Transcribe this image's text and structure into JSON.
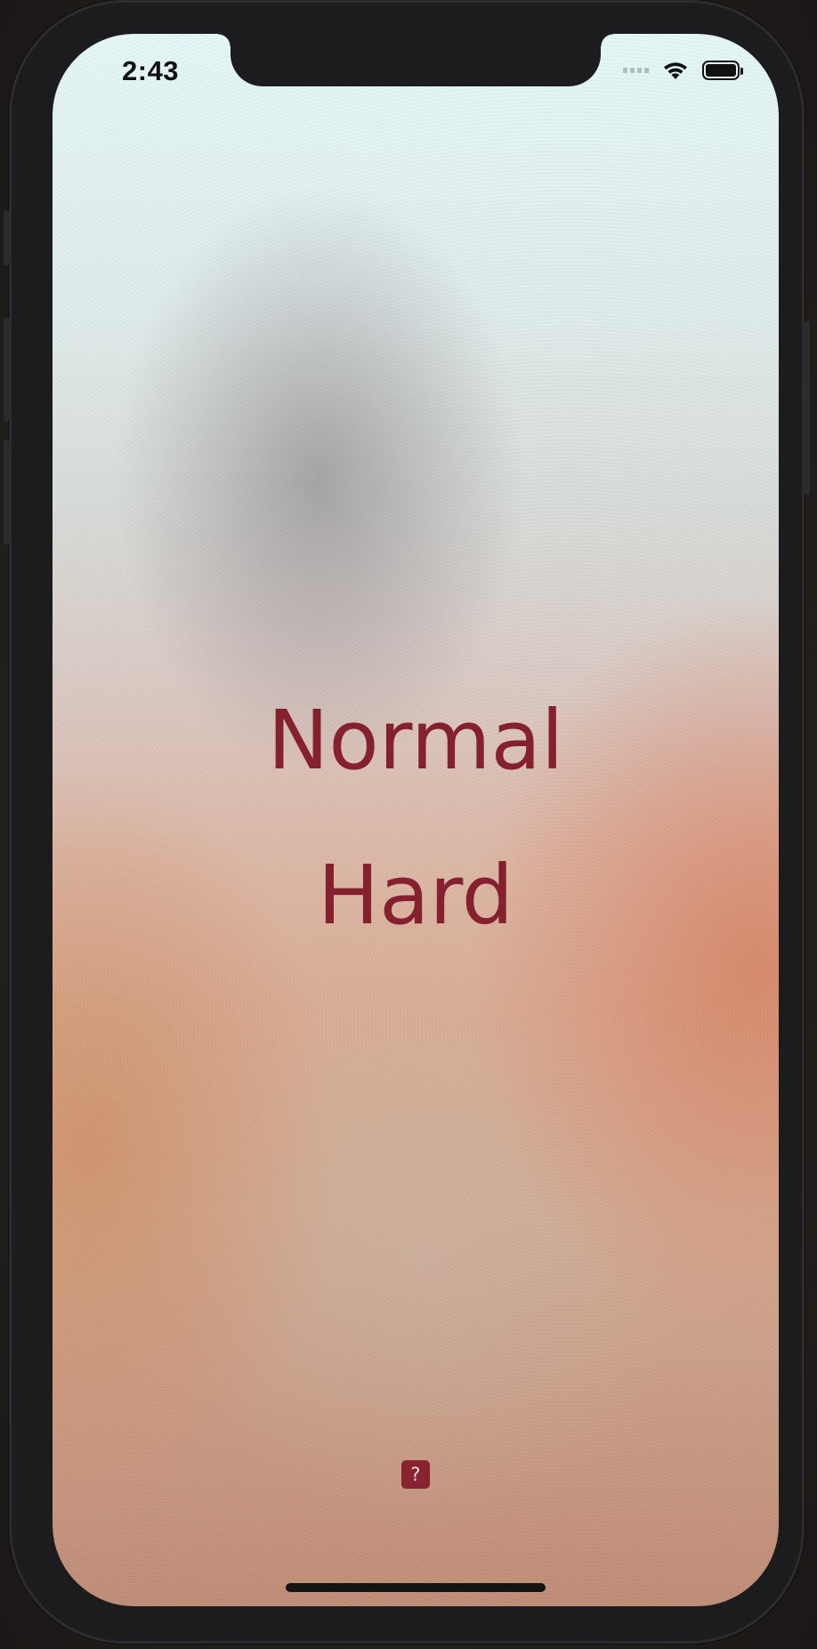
{
  "status_bar": {
    "time": "2:43",
    "icons": [
      "cellular-signal-icon",
      "wifi-icon",
      "battery-icon"
    ],
    "battery_level": 1.0
  },
  "menu": {
    "items": [
      {
        "label": "Normal"
      },
      {
        "label": "Hard"
      }
    ]
  },
  "help_button": {
    "label": "?"
  },
  "colors": {
    "accent": "#85202f",
    "help_button_bg": "#8a2330"
  }
}
